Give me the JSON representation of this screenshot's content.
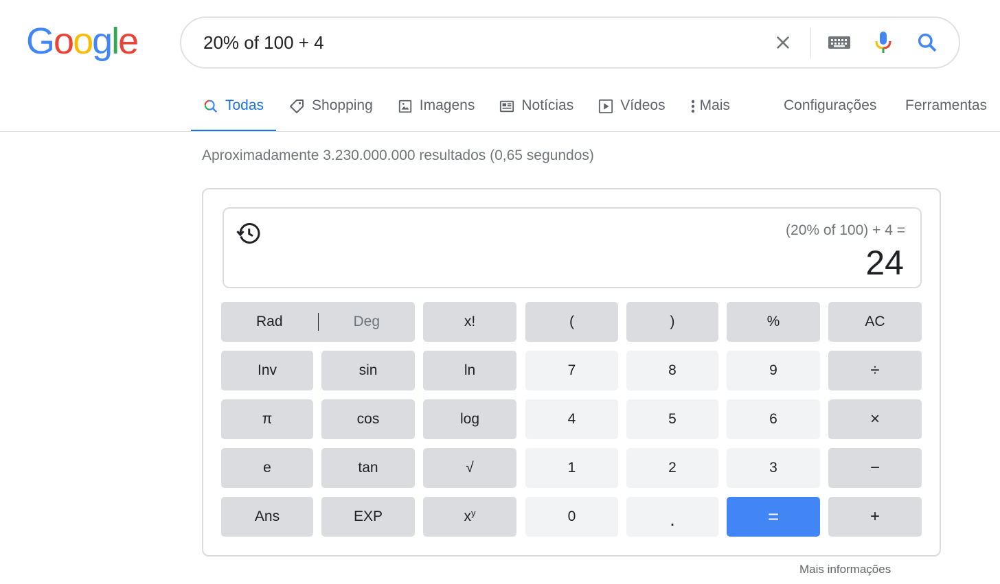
{
  "logo": {
    "letters": [
      "G",
      "o",
      "o",
      "g",
      "l",
      "e"
    ],
    "colors": [
      "#4285f4",
      "#ea4335",
      "#fbbc05",
      "#4285f4",
      "#34a853",
      "#ea4335"
    ]
  },
  "search": {
    "query": "20% of 100 + 4",
    "placeholder": ""
  },
  "tabs": [
    {
      "label": "Todas",
      "icon": "search-icon",
      "active": true
    },
    {
      "label": "Shopping",
      "icon": "tag-icon"
    },
    {
      "label": "Imagens",
      "icon": "image-icon"
    },
    {
      "label": "Notícias",
      "icon": "newspaper-icon"
    },
    {
      "label": "Vídeos",
      "icon": "play-icon"
    },
    {
      "label": "Mais",
      "icon": "more-vert-icon"
    }
  ],
  "tools": {
    "settings": "Configurações",
    "tools": "Ferramentas"
  },
  "results_count": "Aproximadamente 3.230.000.000 resultados (0,65 segundos)",
  "calculator": {
    "expression": "(20% of 100) + 4 =",
    "result": "24",
    "rad": "Rad",
    "deg": "Deg",
    "keys": {
      "fact": "x!",
      "lparen": "(",
      "rparen": ")",
      "percent": "%",
      "ac": "AC",
      "inv": "Inv",
      "sin": "sin",
      "ln": "ln",
      "k7": "7",
      "k8": "8",
      "k9": "9",
      "div": "÷",
      "pi": "π",
      "cos": "cos",
      "log": "log",
      "k4": "4",
      "k5": "5",
      "k6": "6",
      "mul": "×",
      "e": "e",
      "tan": "tan",
      "sqrt": "√",
      "k1": "1",
      "k2": "2",
      "k3": "3",
      "minus": "−",
      "ans": "Ans",
      "exp": "EXP",
      "pow_base": "x",
      "pow_exp": "y",
      "k0": "0",
      "dot": ".",
      "eq": "=",
      "plus": "+"
    }
  },
  "more_info": "Mais informações",
  "colors": {
    "accent": "#1a73e8",
    "equals": "#4285f4"
  }
}
